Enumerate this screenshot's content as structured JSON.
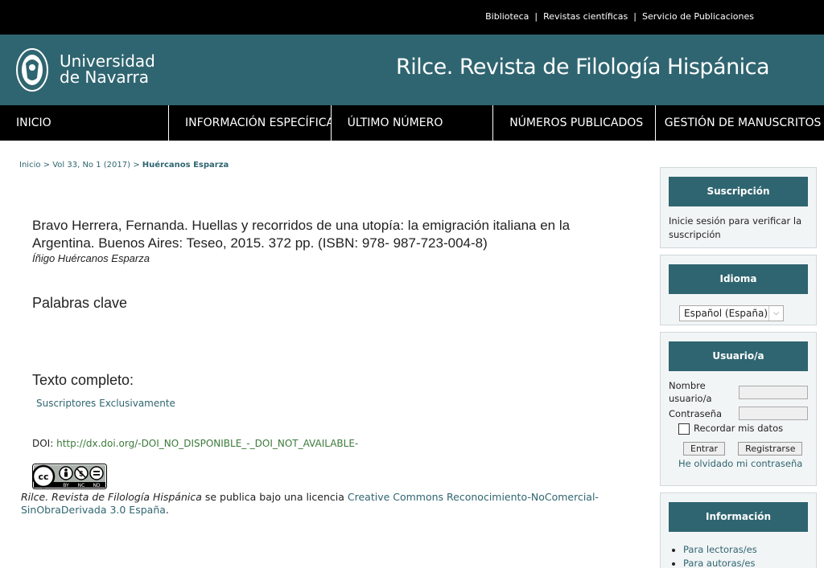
{
  "top_links": [
    "Biblioteca",
    "Revistas científicas",
    "Servicio de Publicaciones"
  ],
  "top_separator": "|",
  "header": {
    "logo_line1": "Universidad",
    "logo_line2": "de Navarra",
    "site_title": "Rilce. Revista de Filología Hispánica"
  },
  "nav": [
    "INICIO",
    "INFORMACIÓN ESPECÍFICA",
    "ÚLTIMO NÚMERO",
    "NÚMEROS PUBLICADOS",
    "GESTIÓN DE MANUSCRITOS"
  ],
  "breadcrumb": {
    "home": "Inicio",
    "sep": ">",
    "issue": "Vol 33, No 1 (2017)",
    "current": "Huércanos Esparza"
  },
  "article": {
    "title": "Bravo Herrera, Fernanda. Huellas y recorridos de una utopía: la emigración italiana en la Argentina. Buenos Aires: Teseo, 2015. 372 pp. (ISBN: 978- 987-723-004-8)",
    "author": "Íñigo Huércanos Esparza",
    "keywords_heading": "Palabras clave",
    "fulltext_heading": "Texto completo:",
    "fulltext_link": "Suscriptores Exclusivamente",
    "doi_label": "DOI:",
    "doi_value": "http://dx.doi.org/-DOI_NO_DISPONIBLE_-_DOI_NOT_AVAILABLE-",
    "license_journal": "Rilce. Revista de Filología Hispánica",
    "license_text": " se publica bajo una licencia ",
    "license_link": "Creative Commons Reconocimiento-NoComercial-SinObraDerivada 3.0 España",
    "license_end": "."
  },
  "cc_badge": {
    "by": "BY",
    "nc": "NC",
    "nd": "ND"
  },
  "sidebar": {
    "subscription": {
      "title": "Suscripción",
      "text": "Inicie sesión para verificar la suscripción"
    },
    "language": {
      "title": "Idioma",
      "selected": "Español (España)"
    },
    "user": {
      "title": "Usuario/a",
      "username_label": "Nombre usuario/a",
      "password_label": "Contraseña",
      "remember_label": "Recordar mis datos",
      "login_button": "Entrar",
      "register_button": "Registrarse",
      "forgot_link": "He olvidado mi contraseña"
    },
    "information": {
      "title": "Información",
      "items": [
        "Para lectoras/es",
        "Para autoras/es"
      ]
    }
  },
  "colors": {
    "header_teal": "#2f6570",
    "black": "#000000",
    "link": "#2f6570",
    "doi_link": "#3c7a3a"
  }
}
